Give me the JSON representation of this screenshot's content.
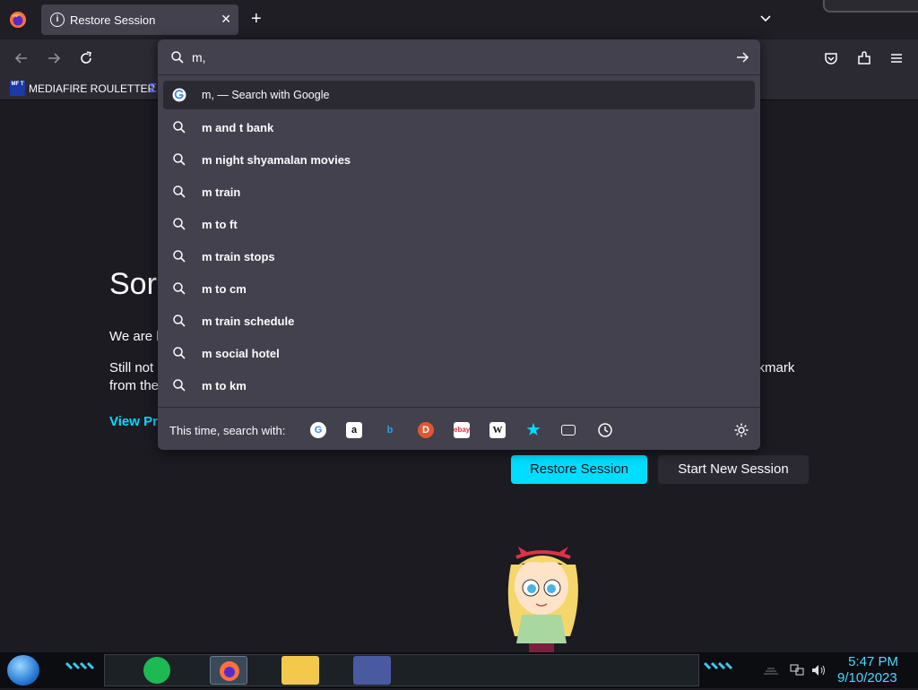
{
  "browser": {
    "tab": {
      "title": "Restore Session"
    },
    "bookmark": {
      "label": "MEDIAFIRE ROULETTER",
      "icon_text": "MF T"
    },
    "urlbar": {
      "value": "m,",
      "suggestions": [
        {
          "text": "m,  — Search with Google",
          "icon": "google-icon"
        },
        {
          "text": "m and t bank",
          "icon": "search-icon"
        },
        {
          "text": "m night shyamalan movies",
          "icon": "search-icon"
        },
        {
          "text": "m train",
          "icon": "search-icon"
        },
        {
          "text": "m to ft",
          "icon": "search-icon"
        },
        {
          "text": "m train stops",
          "icon": "search-icon"
        },
        {
          "text": "m to cm",
          "icon": "search-icon"
        },
        {
          "text": "m train schedule",
          "icon": "search-icon"
        },
        {
          "text": "m social hotel",
          "icon": "search-icon"
        },
        {
          "text": "m to km",
          "icon": "search-icon"
        }
      ],
      "one_off_label": "This time, search with:",
      "engines": [
        "google",
        "amazon",
        "bing",
        "duckduckgo",
        "ebay",
        "wikipedia",
        "bookmarks",
        "tabs",
        "history"
      ]
    }
  },
  "page": {
    "heading": "Sorr",
    "para1": "We are h",
    "para2_start": "Still not",
    "para2_end": "ckmark",
    "para3": "from the",
    "link": "View Pro",
    "restore_button": "Restore Session",
    "new_session_button": "Start New Session"
  },
  "taskbar": {
    "time": "5:47 PM",
    "date": "9/10/2023"
  },
  "colors": {
    "accent": "#00ddff",
    "panel": "#42414d",
    "background": "#1c1b22",
    "clock": "#4fd8ff"
  }
}
